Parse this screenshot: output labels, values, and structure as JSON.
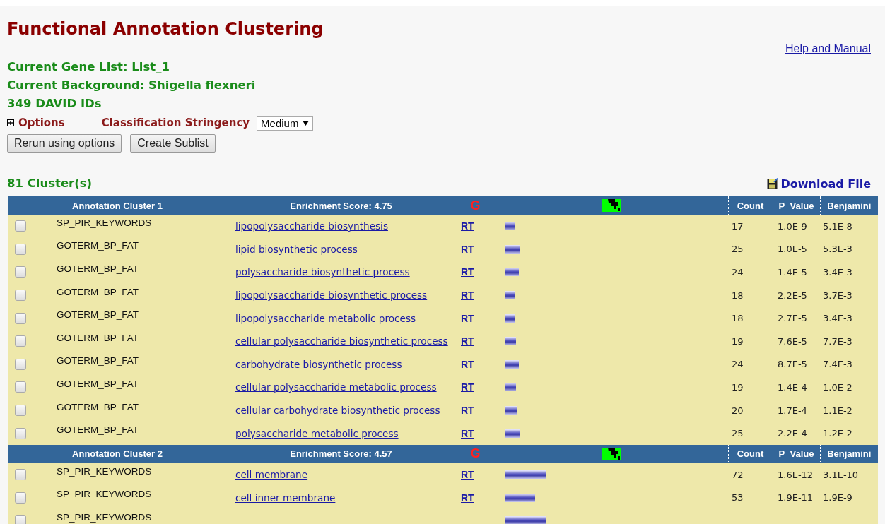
{
  "page": {
    "title": "Functional Annotation Clustering",
    "help_link": "Help and Manual",
    "gene_list": "Current Gene List: List_1",
    "background": "Current Background: Shigella flexneri",
    "id_count": "349 DAVID IDs",
    "options_expanded": false,
    "options_label": "Options",
    "stringency_label": "Classification Stringency",
    "stringency_value": "Medium",
    "buttons": [
      "Rerun using options",
      "Create Sublist"
    ],
    "cluster_count": "81 Cluster(s)",
    "download_link": "Download File"
  },
  "clusters": [
    {
      "title": "Annotation Cluster 1",
      "score": "Enrichment Score: 4.75",
      "g_label": "G",
      "columns": [
        "Count",
        "P_Value",
        "Benjamini"
      ],
      "rows": [
        {
          "checked": false,
          "category": "SP_PIR_KEYWORDS",
          "term": "lipopolysaccharide biosynthesis",
          "rt": "RT",
          "count": "17",
          "p_value": "1.0E-9",
          "benjamini": "5.1E-8"
        },
        {
          "checked": false,
          "category": "GOTERM_BP_FAT",
          "term": "lipid biosynthetic process",
          "rt": "RT",
          "count": "25",
          "p_value": "1.0E-5",
          "benjamini": "5.3E-3"
        },
        {
          "checked": false,
          "category": "GOTERM_BP_FAT",
          "term": "polysaccharide biosynthetic process",
          "rt": "RT",
          "count": "24",
          "p_value": "1.4E-5",
          "benjamini": "3.4E-3"
        },
        {
          "checked": false,
          "category": "GOTERM_BP_FAT",
          "term": "lipopolysaccharide biosynthetic process",
          "rt": "RT",
          "count": "18",
          "p_value": "2.2E-5",
          "benjamini": "3.7E-3"
        },
        {
          "checked": false,
          "category": "GOTERM_BP_FAT",
          "term": "lipopolysaccharide metabolic process",
          "rt": "RT",
          "count": "18",
          "p_value": "2.7E-5",
          "benjamini": "3.4E-3"
        },
        {
          "checked": false,
          "category": "GOTERM_BP_FAT",
          "term": "cellular polysaccharide biosynthetic process",
          "rt": "RT",
          "count": "19",
          "p_value": "7.6E-5",
          "benjamini": "7.7E-3"
        },
        {
          "checked": false,
          "category": "GOTERM_BP_FAT",
          "term": "carbohydrate biosynthetic process",
          "rt": "RT",
          "count": "24",
          "p_value": "8.7E-5",
          "benjamini": "7.4E-3"
        },
        {
          "checked": false,
          "category": "GOTERM_BP_FAT",
          "term": "cellular polysaccharide metabolic process",
          "rt": "RT",
          "count": "19",
          "p_value": "1.4E-4",
          "benjamini": "1.0E-2"
        },
        {
          "checked": false,
          "category": "GOTERM_BP_FAT",
          "term": "cellular carbohydrate biosynthetic process",
          "rt": "RT",
          "count": "20",
          "p_value": "1.7E-4",
          "benjamini": "1.1E-2"
        },
        {
          "checked": false,
          "category": "GOTERM_BP_FAT",
          "term": "polysaccharide metabolic process",
          "rt": "RT",
          "count": "25",
          "p_value": "2.2E-4",
          "benjamini": "1.2E-2"
        }
      ]
    },
    {
      "title": "Annotation Cluster 2",
      "score": "Enrichment Score: 4.57",
      "g_label": "G",
      "columns": [
        "Count",
        "P_Value",
        "Benjamini"
      ],
      "rows": [
        {
          "checked": false,
          "category": "SP_PIR_KEYWORDS",
          "term": "cell membrane",
          "rt": "RT",
          "count": "72",
          "p_value": "1.6E-12",
          "benjamini": "3.1E-10"
        },
        {
          "checked": false,
          "category": "SP_PIR_KEYWORDS",
          "term": "cell inner membrane",
          "rt": "RT",
          "count": "53",
          "p_value": "1.9E-11",
          "benjamini": "1.9E-9"
        },
        {
          "checked": false,
          "category": "SP_PIR_KEYWORDS"
        }
      ]
    }
  ]
}
